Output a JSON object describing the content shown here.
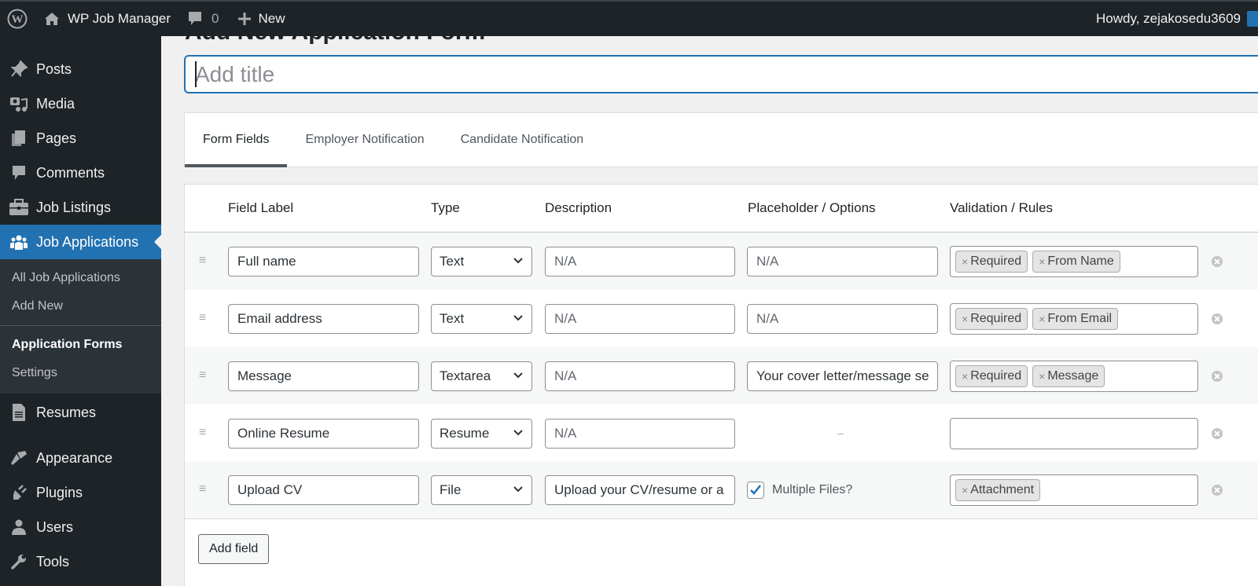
{
  "admin_bar": {
    "site_name": "WP Job Manager",
    "comments_count": "0",
    "new_label": "New",
    "greeting": "Howdy, zejakosedu3609"
  },
  "sidebar": {
    "items_top": [
      {
        "label": "Posts",
        "icon": "pin-icon"
      },
      {
        "label": "Media",
        "icon": "media-icon"
      },
      {
        "label": "Pages",
        "icon": "pages-icon"
      },
      {
        "label": "Comments",
        "icon": "comment-icon"
      },
      {
        "label": "Job Listings",
        "icon": "briefcase-icon"
      },
      {
        "label": "Job Applications",
        "icon": "people-icon",
        "current": true
      }
    ],
    "submenu": [
      "All Job Applications",
      "Add New",
      "Application Forms",
      "Settings"
    ],
    "submenu_current": "Application Forms",
    "items_bottom": [
      {
        "label": "Resumes",
        "icon": "document-icon"
      },
      {
        "label": "Appearance",
        "icon": "brush-icon"
      },
      {
        "label": "Plugins",
        "icon": "plugin-icon"
      },
      {
        "label": "Users",
        "icon": "user-icon"
      },
      {
        "label": "Tools",
        "icon": "wrench-icon"
      }
    ]
  },
  "page": {
    "heading": "Add New Application Form",
    "title_placeholder": "Add title"
  },
  "tabs": [
    {
      "label": "Form Fields",
      "active": true
    },
    {
      "label": "Employer Notification",
      "active": false
    },
    {
      "label": "Candidate Notification",
      "active": false
    }
  ],
  "table": {
    "headers": [
      "Field Label",
      "Type",
      "Description",
      "Placeholder / Options",
      "Validation / Rules"
    ],
    "rows": [
      {
        "label": "Full name",
        "type": "Text",
        "description": "N/A",
        "placeholder": "N/A",
        "rules": [
          "Required",
          "From Name"
        ]
      },
      {
        "label": "Email address",
        "type": "Text",
        "description": "N/A",
        "placeholder": "N/A",
        "rules": [
          "Required",
          "From Email"
        ]
      },
      {
        "label": "Message",
        "type": "Textarea",
        "description": "N/A",
        "placeholder": "Your cover letter/message se",
        "rules": [
          "Required",
          "Message"
        ]
      },
      {
        "label": "Online Resume",
        "type": "Resume",
        "description": "N/A",
        "placeholder": "–",
        "rules": []
      },
      {
        "label": "Upload CV",
        "type": "File",
        "description": "Upload your CV/resume or a",
        "multiple_files_label": "Multiple Files?",
        "multiple_files_checked": true,
        "rules": [
          "Attachment"
        ]
      }
    ],
    "add_field_label": "Add field"
  },
  "colors": {
    "accent": "#2271b1",
    "admin_dark": "#1d2327",
    "submenu_bg": "#2c3338"
  }
}
